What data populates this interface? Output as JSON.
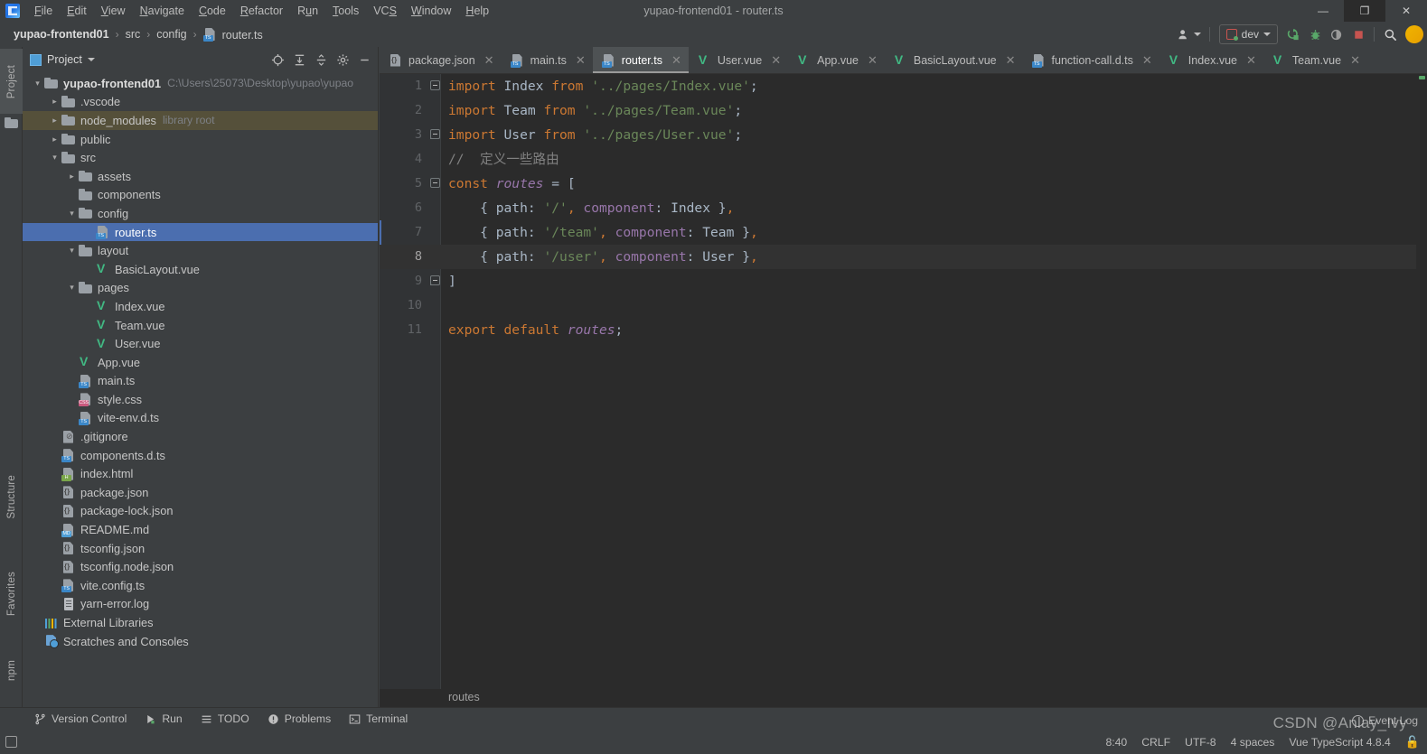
{
  "window": {
    "title": "yupao-frontend01 - router.ts",
    "logo_icon": "intellij-idea-logo",
    "controls": [
      {
        "name": "minimize",
        "glyph": "—"
      },
      {
        "name": "maximize",
        "glyph": "❐"
      },
      {
        "name": "close",
        "glyph": "✕"
      }
    ]
  },
  "menubar": {
    "items": [
      {
        "pre": "",
        "mn": "F",
        "post": "ile"
      },
      {
        "pre": "",
        "mn": "E",
        "post": "dit"
      },
      {
        "pre": "",
        "mn": "V",
        "post": "iew"
      },
      {
        "pre": "",
        "mn": "N",
        "post": "avigate"
      },
      {
        "pre": "",
        "mn": "C",
        "post": "ode"
      },
      {
        "pre": "",
        "mn": "R",
        "post": "efactor"
      },
      {
        "pre": "R",
        "mn": "u",
        "post": "n"
      },
      {
        "pre": "",
        "mn": "T",
        "post": "ools"
      },
      {
        "pre": "VC",
        "mn": "S",
        "post": ""
      },
      {
        "pre": "",
        "mn": "W",
        "post": "indow"
      },
      {
        "pre": "",
        "mn": "H",
        "post": "elp"
      }
    ]
  },
  "breadcrumb": {
    "items": [
      "yupao-frontend01",
      "src",
      "config",
      "router.ts"
    ],
    "separator": "›",
    "file_icon": "ts-file-icon"
  },
  "nav_toolbar": {
    "account_label": "account-icon",
    "run_config": "dev",
    "buttons": [
      {
        "name": "run-button",
        "glyph": "➤"
      },
      {
        "name": "debug-button",
        "glyph": "🐞"
      },
      {
        "name": "run-with-coverage-button",
        "glyph": "◔"
      },
      {
        "name": "stop-button",
        "glyph": "■"
      },
      {
        "name": "search-everywhere-button",
        "glyph": "🔍"
      }
    ]
  },
  "left_stripe": {
    "top": [
      {
        "label": "Project",
        "icon": "project-folder-icon",
        "active": true
      }
    ],
    "bottom": [
      {
        "label": "Structure",
        "icon": "structure-icon"
      },
      {
        "label": "Favorites",
        "icon": "star-icon"
      },
      {
        "label": "npm",
        "icon": "npm-icon"
      }
    ]
  },
  "project_panel": {
    "title": "Project",
    "tools": [
      {
        "name": "select-opened-file-icon",
        "glyph": "⊕"
      },
      {
        "name": "expand-all-icon",
        "glyph": "⤓"
      },
      {
        "name": "collapse-all-icon",
        "glyph": "⤒"
      },
      {
        "name": "settings-gear-icon",
        "glyph": "⚙"
      },
      {
        "name": "hide-panel-icon",
        "glyph": "—"
      }
    ],
    "tree": [
      {
        "indent": 0,
        "arrow": "down",
        "icon": "folder",
        "label": "yupao-frontend01",
        "bold": true,
        "sub": "C:\\Users\\25073\\Desktop\\yupao\\yupao"
      },
      {
        "indent": 1,
        "arrow": "right",
        "icon": "folder",
        "label": ".vscode"
      },
      {
        "indent": 1,
        "arrow": "right",
        "icon": "folder",
        "label": "node_modules",
        "sub": "library root",
        "libroot": true
      },
      {
        "indent": 1,
        "arrow": "right",
        "icon": "folder",
        "label": "public"
      },
      {
        "indent": 1,
        "arrow": "down",
        "icon": "folder",
        "label": "src"
      },
      {
        "indent": 2,
        "arrow": "right",
        "icon": "folder",
        "label": "assets"
      },
      {
        "indent": 2,
        "arrow": "none",
        "icon": "folder",
        "label": "components"
      },
      {
        "indent": 2,
        "arrow": "down",
        "icon": "folder",
        "label": "config"
      },
      {
        "indent": 3,
        "arrow": "none",
        "icon": "ts",
        "label": "router.ts",
        "selected": true
      },
      {
        "indent": 2,
        "arrow": "down",
        "icon": "folder",
        "label": "layout"
      },
      {
        "indent": 3,
        "arrow": "none",
        "icon": "vue",
        "label": "BasicLayout.vue"
      },
      {
        "indent": 2,
        "arrow": "down",
        "icon": "folder",
        "label": "pages"
      },
      {
        "indent": 3,
        "arrow": "none",
        "icon": "vue",
        "label": "Index.vue"
      },
      {
        "indent": 3,
        "arrow": "none",
        "icon": "vue",
        "label": "Team.vue"
      },
      {
        "indent": 3,
        "arrow": "none",
        "icon": "vue",
        "label": "User.vue"
      },
      {
        "indent": 2,
        "arrow": "none",
        "icon": "vue",
        "label": "App.vue"
      },
      {
        "indent": 2,
        "arrow": "none",
        "icon": "ts",
        "label": "main.ts"
      },
      {
        "indent": 2,
        "arrow": "none",
        "icon": "css",
        "label": "style.css"
      },
      {
        "indent": 2,
        "arrow": "none",
        "icon": "ts",
        "label": "vite-env.d.ts"
      },
      {
        "indent": 1,
        "arrow": "none",
        "icon": "git",
        "label": ".gitignore"
      },
      {
        "indent": 1,
        "arrow": "none",
        "icon": "ts",
        "label": "components.d.ts"
      },
      {
        "indent": 1,
        "arrow": "none",
        "icon": "html",
        "label": "index.html"
      },
      {
        "indent": 1,
        "arrow": "none",
        "icon": "json",
        "label": "package.json"
      },
      {
        "indent": 1,
        "arrow": "none",
        "icon": "json",
        "label": "package-lock.json"
      },
      {
        "indent": 1,
        "arrow": "none",
        "icon": "md",
        "label": "README.md"
      },
      {
        "indent": 1,
        "arrow": "none",
        "icon": "json",
        "label": "tsconfig.json"
      },
      {
        "indent": 1,
        "arrow": "none",
        "icon": "json",
        "label": "tsconfig.node.json"
      },
      {
        "indent": 1,
        "arrow": "none",
        "icon": "ts",
        "label": "vite.config.ts"
      },
      {
        "indent": 1,
        "arrow": "none",
        "icon": "log",
        "label": "yarn-error.log"
      },
      {
        "indent": 0,
        "arrow": "none",
        "icon": "extlib",
        "label": "External Libraries"
      },
      {
        "indent": 0,
        "arrow": "none",
        "icon": "scratch",
        "label": "Scratches and Consoles"
      }
    ]
  },
  "editor": {
    "tabs": [
      {
        "label": "package.json",
        "icon": "json",
        "active": false
      },
      {
        "label": "main.ts",
        "icon": "ts",
        "active": false
      },
      {
        "label": "router.ts",
        "icon": "ts",
        "active": true
      },
      {
        "label": "User.vue",
        "icon": "vue",
        "active": false
      },
      {
        "label": "App.vue",
        "icon": "vue",
        "active": false
      },
      {
        "label": "BasicLayout.vue",
        "icon": "vue",
        "active": false
      },
      {
        "label": "function-call.d.ts",
        "icon": "ts",
        "active": false
      },
      {
        "label": "Index.vue",
        "icon": "vue",
        "active": false
      },
      {
        "label": "Team.vue",
        "icon": "vue",
        "active": false
      }
    ],
    "tab_close_glyph": "✕",
    "breadcrumb": "routes",
    "lines": [
      {
        "n": "1",
        "fold": "start",
        "tokens": [
          {
            "t": "kw",
            "v": "import"
          },
          {
            "t": "def",
            "v": " Index "
          },
          {
            "t": "kw",
            "v": "from"
          },
          {
            "t": "def",
            "v": " "
          },
          {
            "t": "str",
            "v": "'../pages/Index.vue'"
          },
          {
            "t": "punc",
            "v": ";"
          }
        ]
      },
      {
        "n": "2",
        "fold": "",
        "tokens": [
          {
            "t": "kw",
            "v": "import"
          },
          {
            "t": "def",
            "v": " Team "
          },
          {
            "t": "kw",
            "v": "from"
          },
          {
            "t": "def",
            "v": " "
          },
          {
            "t": "str",
            "v": "'../pages/Team.vue'"
          },
          {
            "t": "punc",
            "v": ";"
          }
        ]
      },
      {
        "n": "3",
        "fold": "end",
        "tokens": [
          {
            "t": "kw",
            "v": "import"
          },
          {
            "t": "def",
            "v": " User "
          },
          {
            "t": "kw",
            "v": "from"
          },
          {
            "t": "def",
            "v": " "
          },
          {
            "t": "str",
            "v": "'../pages/User.vue'"
          },
          {
            "t": "punc",
            "v": ";"
          }
        ]
      },
      {
        "n": "4",
        "fold": "",
        "tokens": [
          {
            "t": "cmt",
            "v": "//  定义一些路由"
          }
        ]
      },
      {
        "n": "5",
        "fold": "start",
        "tokens": [
          {
            "t": "kw",
            "v": "const"
          },
          {
            "t": "def",
            "v": " "
          },
          {
            "t": "var",
            "v": "routes"
          },
          {
            "t": "def",
            "v": " "
          },
          {
            "t": "punc",
            "v": "="
          },
          {
            "t": "def",
            "v": " "
          },
          {
            "t": "punc",
            "v": "["
          }
        ]
      },
      {
        "n": "6",
        "fold": "",
        "tokens": [
          {
            "t": "def",
            "v": "    "
          },
          {
            "t": "punc",
            "v": "{ "
          },
          {
            "t": "def",
            "v": "path"
          },
          {
            "t": "punc",
            "v": ": "
          },
          {
            "t": "str",
            "v": "'/'"
          },
          {
            "t": "kw",
            "v": ", "
          },
          {
            "t": "prop",
            "v": "component"
          },
          {
            "t": "punc",
            "v": ": "
          },
          {
            "t": "def",
            "v": "Index "
          },
          {
            "t": "punc",
            "v": "}"
          },
          {
            "t": "kw",
            "v": ","
          }
        ]
      },
      {
        "n": "7",
        "fold": "",
        "caret_gutter": true,
        "tokens": [
          {
            "t": "def",
            "v": "    "
          },
          {
            "t": "punc",
            "v": "{ "
          },
          {
            "t": "def",
            "v": "path"
          },
          {
            "t": "punc",
            "v": ": "
          },
          {
            "t": "str",
            "v": "'/team'"
          },
          {
            "t": "kw",
            "v": ", "
          },
          {
            "t": "prop",
            "v": "component"
          },
          {
            "t": "punc",
            "v": ": "
          },
          {
            "t": "def",
            "v": "Team "
          },
          {
            "t": "punc",
            "v": "}"
          },
          {
            "t": "kw",
            "v": ","
          }
        ]
      },
      {
        "n": "8",
        "fold": "",
        "current": true,
        "tokens": [
          {
            "t": "def",
            "v": "    "
          },
          {
            "t": "punc",
            "v": "{ "
          },
          {
            "t": "def",
            "v": "path"
          },
          {
            "t": "punc",
            "v": ": "
          },
          {
            "t": "str",
            "v": "'/user'"
          },
          {
            "t": "kw",
            "v": ", "
          },
          {
            "t": "prop",
            "v": "component"
          },
          {
            "t": "punc",
            "v": ": "
          },
          {
            "t": "def",
            "v": "User "
          },
          {
            "t": "punc",
            "v": "}"
          },
          {
            "t": "kw",
            "v": ","
          }
        ]
      },
      {
        "n": "9",
        "fold": "end",
        "tokens": [
          {
            "t": "punc",
            "v": "]"
          }
        ]
      },
      {
        "n": "10",
        "fold": "",
        "tokens": []
      },
      {
        "n": "11",
        "fold": "",
        "tokens": [
          {
            "t": "kw",
            "v": "export default"
          },
          {
            "t": "def",
            "v": " "
          },
          {
            "t": "var",
            "v": "routes"
          },
          {
            "t": "punc",
            "v": ";"
          }
        ]
      }
    ]
  },
  "bottom_bar": {
    "items": [
      {
        "label": "Version Control",
        "icon": "branch-icon",
        "glyph": "⑂"
      },
      {
        "label": "Run",
        "icon": "play-icon",
        "glyph": "▶"
      },
      {
        "label": "TODO",
        "icon": "list-icon",
        "glyph": "☰"
      },
      {
        "label": "Problems",
        "icon": "warning-icon",
        "glyph": "❗"
      },
      {
        "label": "Terminal",
        "icon": "terminal-icon",
        "glyph": "▸"
      }
    ]
  },
  "status_bar": {
    "caret_position": "8:40",
    "line_separator": "CRLF",
    "encoding": "UTF-8",
    "indent": "4 spaces",
    "language_level": "Vue TypeScript 4.8.4",
    "lock_icon": "🔓",
    "event_log": "Event Log"
  },
  "watermark": "CSDN @Anlay_Ivy"
}
